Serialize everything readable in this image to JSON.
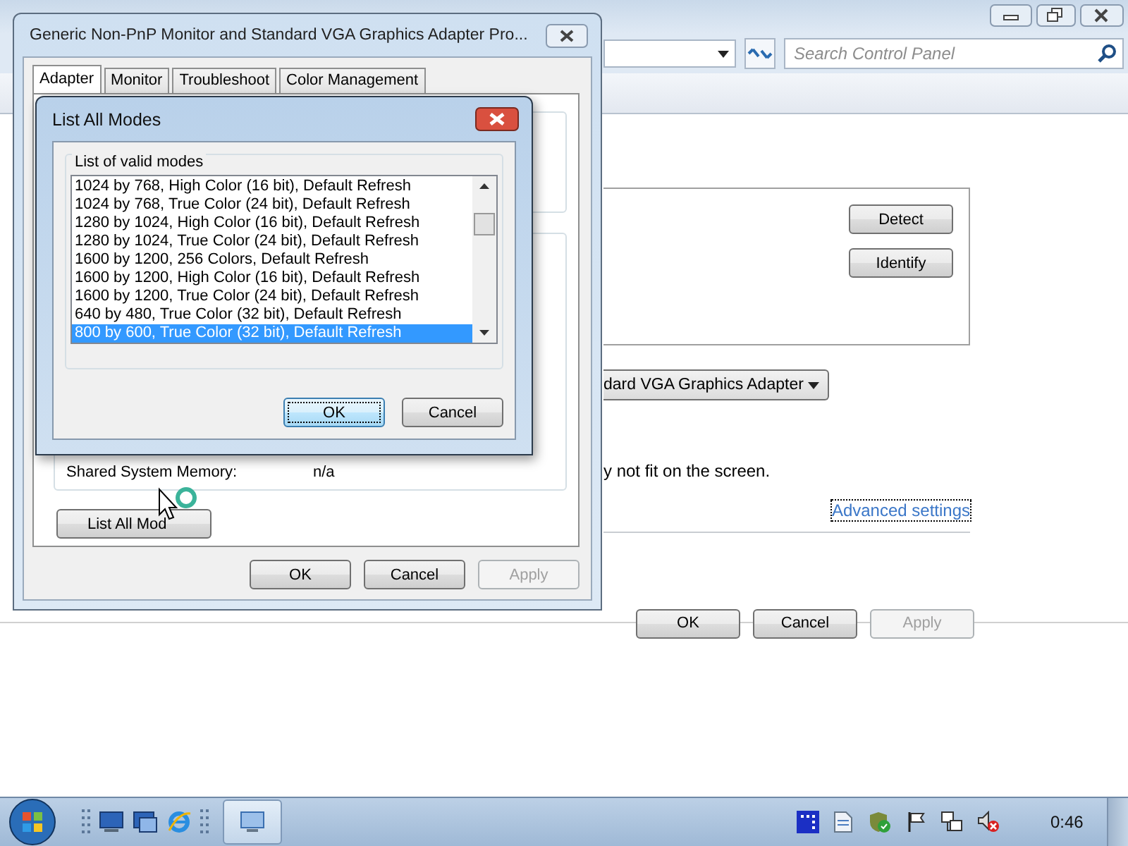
{
  "background_window": {
    "search_placeholder": "Search Control Panel",
    "side_buttons": [
      "Detect",
      "Identify"
    ],
    "adapter_dropdown": "dard VGA Graphics Adapter",
    "note": "y not fit on the screen.",
    "link": "Advanced settings",
    "buttons": [
      {
        "label": "OK",
        "disabled": false
      },
      {
        "label": "Cancel",
        "disabled": false
      },
      {
        "label": "Apply",
        "disabled": true
      }
    ]
  },
  "properties_dialog": {
    "title": "Generic Non-PnP Monitor and Standard VGA Graphics Adapter Pro...",
    "tabs": [
      {
        "label": "Adapter",
        "selected": true
      },
      {
        "label": "Monitor",
        "selected": false
      },
      {
        "label": "Troubleshoot",
        "selected": false
      },
      {
        "label": "Color Management",
        "selected": false
      }
    ],
    "info": [
      {
        "label": "Shared System Memory:",
        "value": "n/a"
      }
    ],
    "list_modes_button": "List All Mod",
    "buttons": [
      {
        "label": "OK",
        "disabled": false
      },
      {
        "label": "Cancel",
        "disabled": false
      },
      {
        "label": "Apply",
        "disabled": true
      }
    ]
  },
  "modes_dialog": {
    "title": "List All Modes",
    "group_label": "List of valid modes",
    "modes": [
      {
        "label": "1024 by 768, High Color (16 bit), Default Refresh",
        "selected": false
      },
      {
        "label": "1024 by 768, True Color (24 bit), Default Refresh",
        "selected": false
      },
      {
        "label": "1280 by 1024, High Color (16 bit), Default Refresh",
        "selected": false
      },
      {
        "label": "1280 by 1024, True Color (24 bit), Default Refresh",
        "selected": false
      },
      {
        "label": "1600 by 1200, 256 Colors, Default Refresh",
        "selected": false
      },
      {
        "label": "1600 by 1200, High Color (16 bit), Default Refresh",
        "selected": false
      },
      {
        "label": "1600 by 1200, True Color (24 bit), Default Refresh",
        "selected": false
      },
      {
        "label": "640 by 480, True Color (32 bit), Default Refresh",
        "selected": false
      },
      {
        "label": "800 by 600, True Color (32 bit), Default Refresh",
        "selected": true
      }
    ],
    "buttons": [
      {
        "label": "OK",
        "focused": true
      },
      {
        "label": "Cancel",
        "focused": false
      }
    ]
  },
  "taskbar": {
    "clock": "0:46"
  }
}
